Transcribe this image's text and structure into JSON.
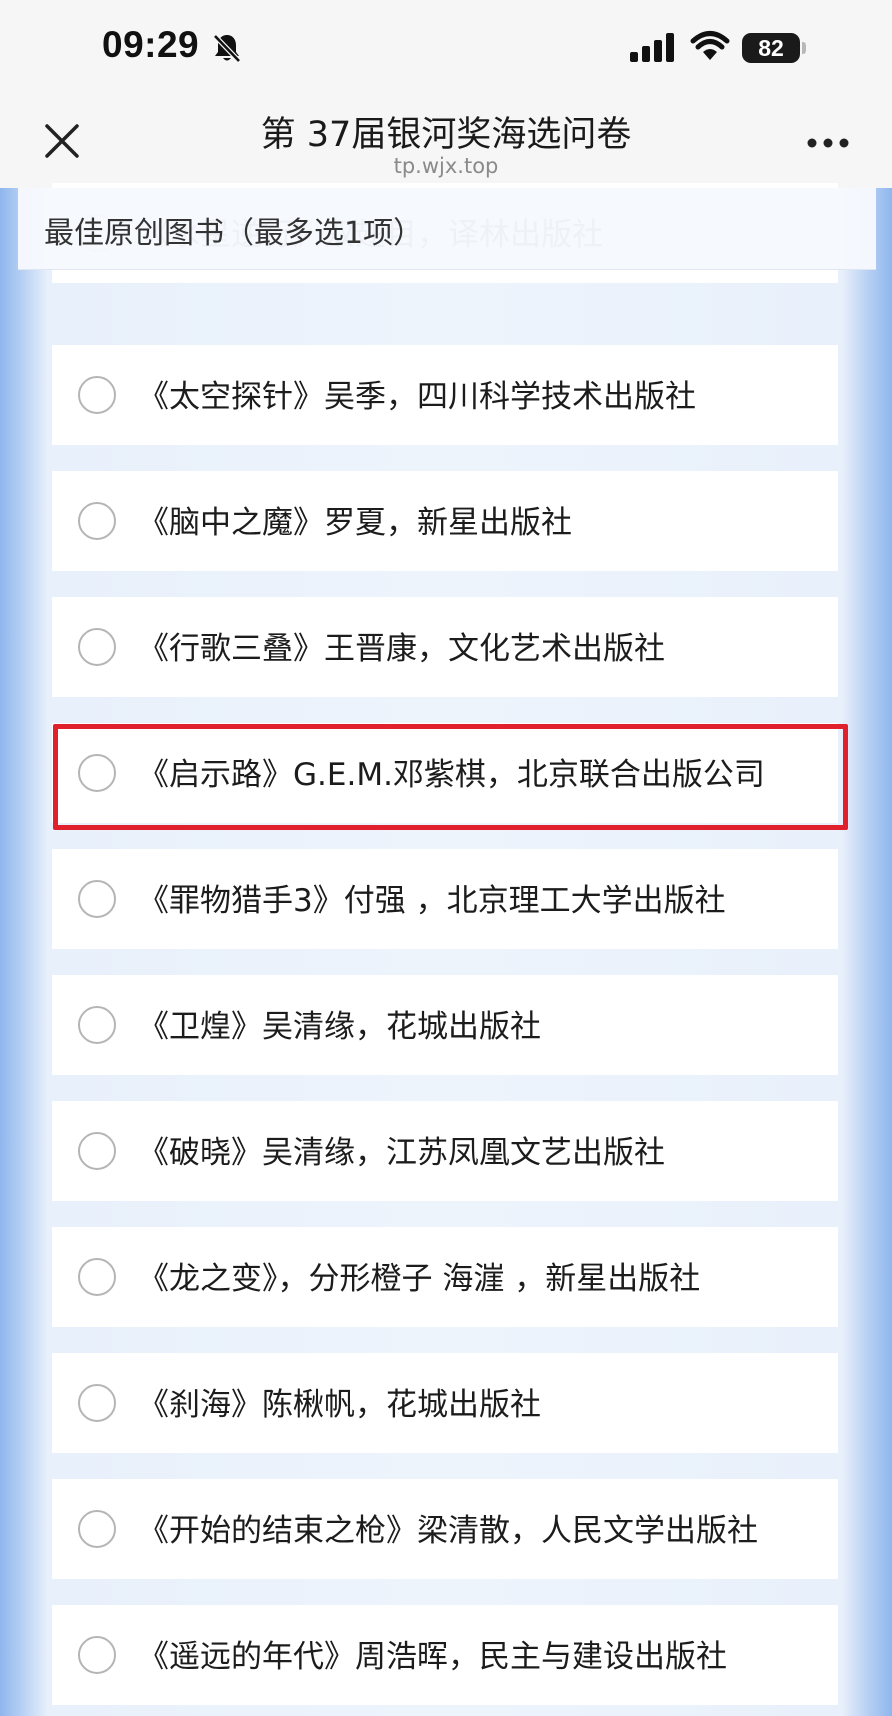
{
  "status_bar": {
    "time": "09:29",
    "battery": "82",
    "icons": [
      "bell-slash-icon",
      "cellular-signal-icon",
      "wifi-icon",
      "battery-icon"
    ]
  },
  "nav": {
    "title": "第 37届银河奖海选问卷",
    "subtitle": "tp.wjx.top",
    "icons": [
      "close-icon",
      "more-icon"
    ]
  },
  "question": {
    "title": "最佳原创图书（最多选1项）"
  },
  "options": [
    {
      "label": "《水星逆行》双翅目，译林出版社"
    },
    {
      "label": "《太空探针》吴季，四川科学技术出版社"
    },
    {
      "label": "《脑中之魔》罗夏，新星出版社"
    },
    {
      "label": "《行歌三叠》王晋康，文化艺术出版社"
    },
    {
      "label": "《启示路》G.E.M.邓紫棋，北京联合出版公司"
    },
    {
      "label": "《罪物猎手3》付强 ，北京理工大学出版社"
    },
    {
      "label": "《卫煌》吴清缘，花城出版社"
    },
    {
      "label": "《破晓》吴清缘，江苏凤凰文艺出版社"
    },
    {
      "label": "《龙之变》，分形橙子 海漄 ，新星出版社"
    },
    {
      "label": "《刹海》陈楸帆，花城出版社"
    },
    {
      "label": "《开始的结束之枪》梁清散，人民文学出版社"
    },
    {
      "label": "《遥远的年代》周浩晖，民主与建设出版社"
    }
  ],
  "colors": {
    "highlight": "#e0202c",
    "page_bg": "#eef4fc",
    "option_bg": "#ffffff"
  }
}
